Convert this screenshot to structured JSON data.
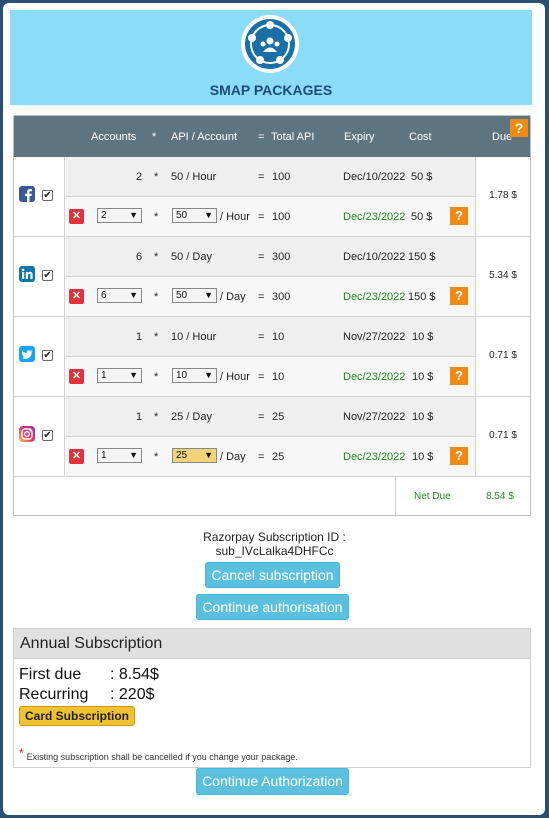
{
  "header": {
    "title": "SMAP PACKAGES",
    "logo_icon": "social-network-logo-icon"
  },
  "table": {
    "headers": {
      "accounts": "Accounts",
      "times": "*",
      "api_per_account": "API / Account",
      "equals": "=",
      "total_api": "Total API",
      "expiry": "Expiry",
      "cost": "Cost",
      "due": "Due"
    },
    "help": "?",
    "rows": [
      {
        "network": "facebook",
        "icon": "facebook-icon",
        "color": "#3b5998",
        "checked": "✔",
        "current": {
          "accounts": "2",
          "api": "50 / Hour",
          "total": "100",
          "expiry": "Dec/10/2022",
          "cost": "50 $"
        },
        "new": {
          "accounts": "2",
          "api": "50",
          "unit": "/ Hour",
          "total": "100",
          "expiry": "Dec/23/2022",
          "cost": "50 $"
        },
        "due": "1.78 $"
      },
      {
        "network": "linkedin",
        "icon": "linkedin-icon",
        "color": "#0e76a8",
        "checked": "✔",
        "current": {
          "accounts": "6",
          "api": "50 / Day",
          "total": "300",
          "expiry": "Dec/10/2022",
          "cost": "150 $"
        },
        "new": {
          "accounts": "6",
          "api": "50",
          "unit": "/ Day",
          "total": "300",
          "expiry": "Dec/23/2022",
          "cost": "150 $"
        },
        "due": "5.34 $"
      },
      {
        "network": "twitter",
        "icon": "twitter-icon",
        "color": "#1da1f2",
        "checked": "✔",
        "current": {
          "accounts": "1",
          "api": "10 / Hour",
          "total": "10",
          "expiry": "Nov/27/2022",
          "cost": "10 $"
        },
        "new": {
          "accounts": "1",
          "api": "10",
          "unit": "/ Hour",
          "total": "10",
          "expiry": "Dec/23/2022",
          "cost": "10 $"
        },
        "due": "0.71 $"
      },
      {
        "network": "instagram",
        "icon": "instagram-icon",
        "color": "#d6249f",
        "checked": "✔",
        "current": {
          "accounts": "1",
          "api": "25 / Day",
          "total": "25",
          "expiry": "Nov/27/2022",
          "cost": "10 $"
        },
        "new": {
          "accounts": "1",
          "api": "25",
          "unit": "/ Day",
          "total": "25",
          "expiry": "Dec/23/2022",
          "cost": "10 $"
        },
        "due": "0.71 $"
      }
    ],
    "net_due_label": "Net Due",
    "net_due_value": "8.54 $"
  },
  "razorpay": {
    "label": "Razorpay Subscription ID :",
    "id": "sub_IVcLalka4DHFCc"
  },
  "buttons": {
    "cancel": "Cancel subscription",
    "continue_auth": "Continue authorisation",
    "continue_authorization": "Continue Authorization"
  },
  "annual": {
    "title": "Annual Subscription",
    "first_due_label": "First due",
    "first_due_value": ": 8.54$",
    "recurring_label": "Recurring",
    "recurring_value": ": 220$",
    "card_button": "Card Subscription",
    "note_star": "*",
    "note": "Existing subscription shall be cancelled if you change your package."
  },
  "colors": {
    "header_bg": "#8bdcf7",
    "table_head": "#5f7481",
    "help": "#f08a12",
    "green": "#1f8a1f",
    "button": "#5bc0de",
    "card_button": "#f0c131"
  }
}
